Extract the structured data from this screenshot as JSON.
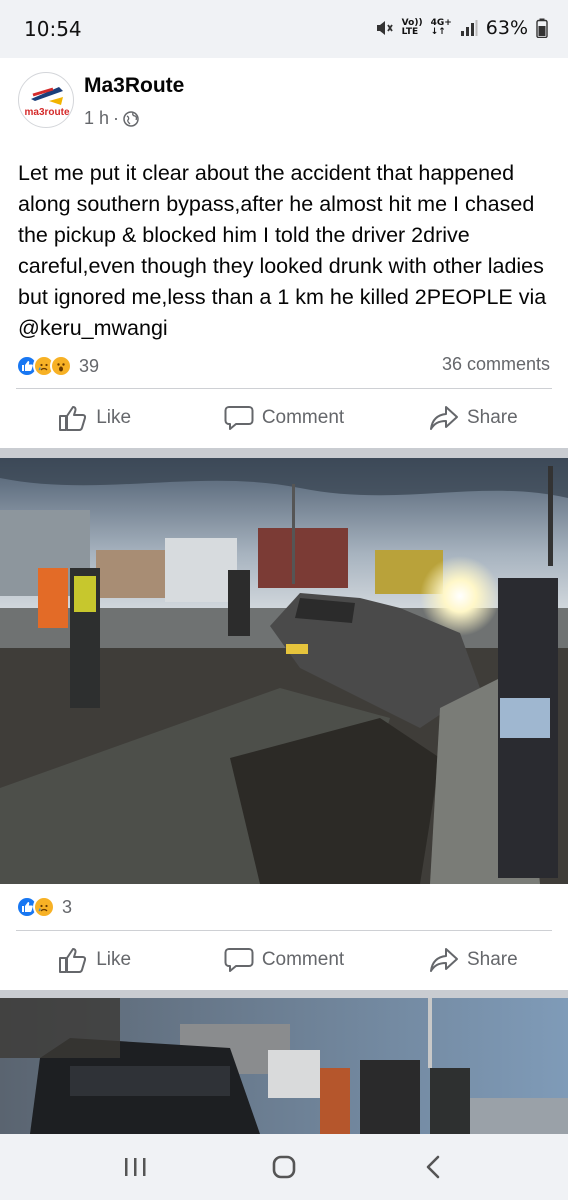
{
  "status_bar": {
    "time": "10:54",
    "volte_top": "Vo))",
    "volte_bottom": "LTE",
    "network_top": "4G+",
    "network_bottom": "↓↑",
    "battery": "63%"
  },
  "post": {
    "page_name": "Ma3Route",
    "logo_text": "ma3route",
    "time_ago": "1 h",
    "separator": "·",
    "audience_icon": "globe-icon",
    "text": "Let me put it clear about the accident that happened along southern bypass,after he almost hit me I chased the pickup & blocked him I told the driver 2drive careful,even though they looked drunk with other ladies but ignored me,less than a 1 km he killed 2PEOPLE via @keru_mwangi",
    "reaction_icons": [
      "like-icon",
      "sad-icon",
      "wow-icon"
    ],
    "reaction_count": "39",
    "comments": "36 comments",
    "actions": {
      "like": "Like",
      "comment": "Comment",
      "share": "Share"
    }
  },
  "photo1": {
    "reaction_icons": [
      "like-icon",
      "sad-icon"
    ],
    "reaction_count": "3",
    "actions": {
      "like": "Like",
      "comment": "Comment",
      "share": "Share"
    }
  },
  "colors": {
    "accent": "#1877f2",
    "reaction_yellow": "#f7b125",
    "secondary_text": "#65676b",
    "separator_bg": "#c9ccd1"
  },
  "nav": {
    "icons": [
      "recent-apps-icon",
      "home-icon",
      "back-icon"
    ]
  }
}
